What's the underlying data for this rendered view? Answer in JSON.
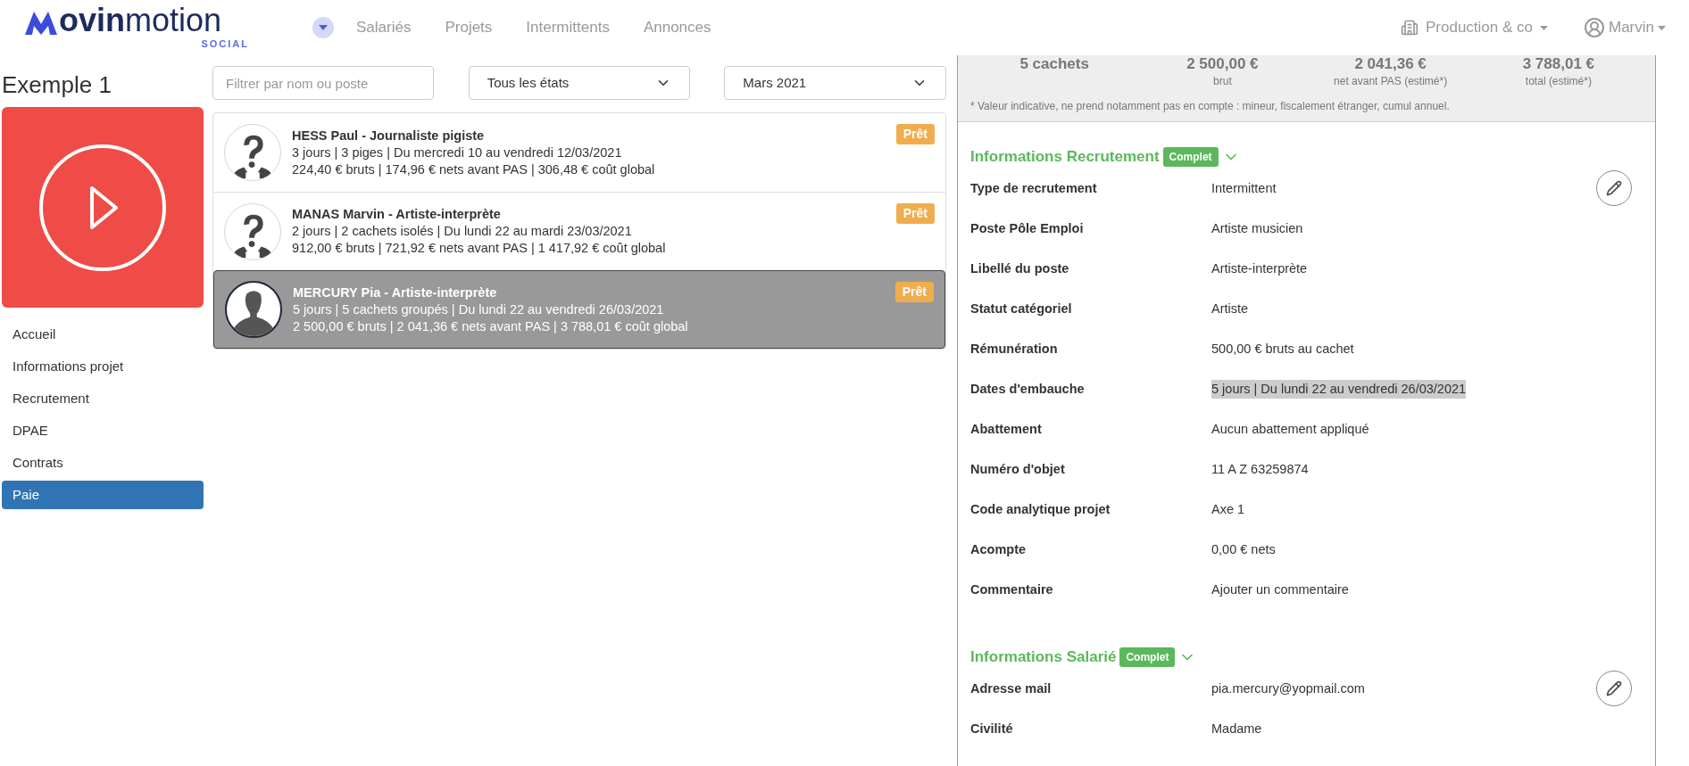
{
  "header": {
    "logo": {
      "wordmark_bold": "ovin",
      "wordmark_light": "motion",
      "subtitle": "SOCIAL"
    },
    "nav": [
      {
        "label": "Salariés",
        "selected": false
      },
      {
        "label": "Projets",
        "selected": false
      },
      {
        "label": "Intermittents",
        "selected": false
      },
      {
        "label": "Annonces",
        "selected": false
      }
    ],
    "company": "Production & co",
    "user": "Marvin"
  },
  "sidebar": {
    "title": "Exemple 1",
    "items": [
      {
        "label": "Accueil",
        "selected": false
      },
      {
        "label": "Informations projet",
        "selected": false
      },
      {
        "label": "Recrutement",
        "selected": false
      },
      {
        "label": "DPAE",
        "selected": false
      },
      {
        "label": "Contrats",
        "selected": false
      },
      {
        "label": "Paie",
        "selected": true
      }
    ]
  },
  "filters": {
    "search": {
      "placeholder": "Filtrer par nom ou poste"
    },
    "state": "Tous les états",
    "month": "Mars 2021"
  },
  "employees": [
    {
      "name": "HESS Paul - Journaliste pigiste",
      "line_1": "3 jours | 3 piges | Du mercredi 10 au vendredi 12/03/2021",
      "line_2": "224,40 € bruts | 174,96 € nets avant PAS | 306,48 € coût global",
      "status": "Prêt",
      "photo": false,
      "selected": false
    },
    {
      "name": "MANAS Marvin - Artiste-interprète",
      "line_1": "2 jours | 2 cachets isolés | Du lundi 22 au mardi 23/03/2021",
      "line_2": "912,00 € bruts | 721,92 € nets avant PAS | 1 417,92 € coût global",
      "status": "Prêt",
      "photo": false,
      "selected": false
    },
    {
      "name": "MERCURY Pia - Artiste-interprète",
      "line_1": "5 jours | 5 cachets groupés | Du lundi 22 au vendredi 26/03/2021",
      "line_2": "2 500,00 € bruts | 2 041,36 € nets avant PAS | 3 788,01 € coût global",
      "status": "Prêt",
      "photo": true,
      "selected": true
    }
  ],
  "summary": {
    "items": [
      {
        "value": "5 cachets"
      },
      {
        "value": "2 500,00 €",
        "caption": "brut"
      },
      {
        "value": "2 041,36 €",
        "caption": "net avant PAS (estimé*)"
      },
      {
        "value": "3 788,01 €",
        "caption": "total (estimé*)"
      }
    ],
    "note": "* Valeur indicative, ne prend notamment pas en compte : mineur, fiscalement étranger, cumul annuel."
  },
  "sections": [
    {
      "title": "Informations Recrutement",
      "badge": "Complet",
      "expanded": true,
      "rows": [
        {
          "label": "Type de recrutement",
          "value": "Intermittent",
          "highlighted": false
        },
        {
          "label": "Poste Pôle Emploi",
          "value": "Artiste musicien",
          "highlighted": false
        },
        {
          "label": "Libellé du poste",
          "value": "Artiste-interprète",
          "highlighted": false
        },
        {
          "label": "Statut catégoriel",
          "value": "Artiste",
          "highlighted": false
        },
        {
          "label": "Rémunération",
          "value": "500,00 € bruts au cachet",
          "highlighted": false
        },
        {
          "label": "Dates d'embauche",
          "value": "5 jours | Du lundi 22 au vendredi 26/03/2021",
          "highlighted": true
        },
        {
          "label": "Abattement",
          "value": "Aucun abattement appliqué",
          "highlighted": false
        },
        {
          "label": "Numéro d'objet",
          "value": "11 A Z 63259874",
          "highlighted": false
        },
        {
          "label": "Code analytique projet",
          "value": "Axe 1",
          "highlighted": false
        },
        {
          "label": "Acompte",
          "value": "0,00 € nets",
          "highlighted": false
        },
        {
          "label": "Commentaire",
          "value": "Ajouter un commentaire",
          "highlighted": false
        }
      ]
    },
    {
      "title": "Informations Salarié",
      "badge": "Complet",
      "expanded": true,
      "rows": [
        {
          "label": "Adresse mail",
          "value": "pia.mercury@yopmail.com",
          "highlighted": false
        },
        {
          "label": "Civilité",
          "value": "Madame",
          "highlighted": false
        }
      ]
    }
  ]
}
